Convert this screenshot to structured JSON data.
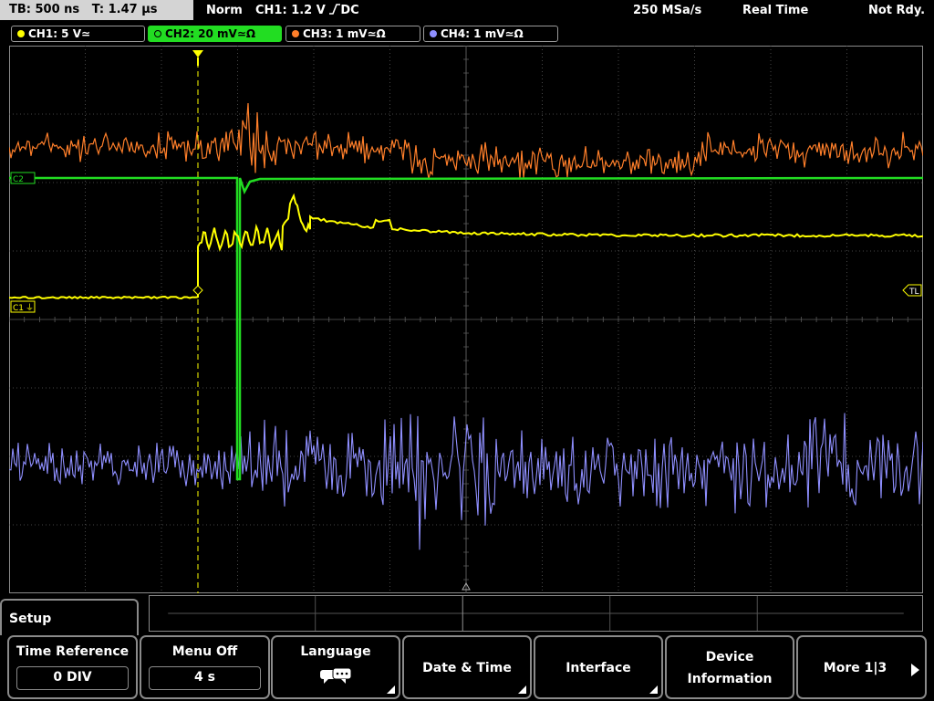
{
  "status": {
    "timebase": "TB: 500 ns",
    "trigger_time": "T: 1.47 µs",
    "mode": "Norm",
    "trigger_info": "CH1: 1.2 V",
    "coupling": "DC",
    "sample_rate": "250 MSa/s",
    "acq_mode": "Real Time",
    "ready_state": "Not Rdy."
  },
  "channels": [
    {
      "label": "CH1: 5 V",
      "suffix": "≃",
      "color": "#ffff00",
      "active": false
    },
    {
      "label": "CH2: 20 mV",
      "suffix": "≃Ω",
      "color": "#22dd22",
      "active": true
    },
    {
      "label": "CH3: 1 mV",
      "suffix": "≃Ω",
      "color": "#ff7f2a",
      "active": false
    },
    {
      "label": "CH4: 1 mV",
      "suffix": "≃Ω",
      "color": "#8f8fff",
      "active": false
    }
  ],
  "markers": {
    "ch1": "C1",
    "ch2": "C2",
    "trigger_level": "TL"
  },
  "menu": {
    "title": "Setup",
    "softkeys": [
      {
        "label": "Time Reference",
        "value": "0 DIV"
      },
      {
        "label": "Menu Off",
        "value": "4 s"
      },
      {
        "label": "Language",
        "icon": "speech-bubble-icon"
      },
      {
        "label": "Date & Time"
      },
      {
        "label": "Interface"
      },
      {
        "label": "Device",
        "label2": "Information"
      },
      {
        "label": "More 1|3"
      }
    ]
  },
  "colors": {
    "ch1": "#ffff00",
    "ch2": "#22dd22",
    "ch3": "#ff7f2a",
    "ch4": "#8f8fff",
    "grid": "#5a5a5a"
  }
}
